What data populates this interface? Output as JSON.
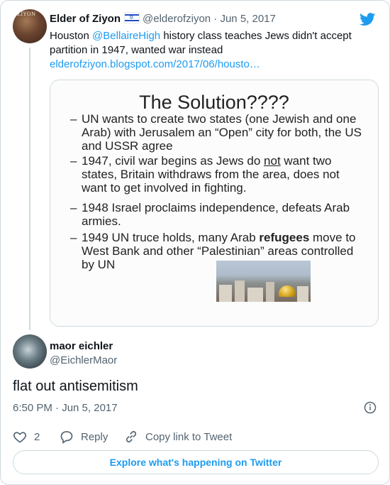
{
  "quoted_tweet": {
    "author_name": "Elder of Ziyon",
    "avatar_text": "ZIYON",
    "handle": "@elderofziyon",
    "separator": "·",
    "date": "Jun 5, 2017",
    "text_part1": "Houston ",
    "mention": "@BellaireHigh",
    "text_part2": " history class teaches Jews didn't accept partition in 1947, wanted war instead",
    "link": "elderofziyon.blogspot.com/2017/06/housto…"
  },
  "slide": {
    "title": "The Solution????",
    "bullets": [
      {
        "dash": "–",
        "text": "UN wants to create two states (one Jewish and one Arab) with Jerusalem an “Open” city for both, the US and USSR agree"
      },
      {
        "dash": "–",
        "text_a": "1947, civil war begins as Jews do ",
        "text_u": "not",
        "text_b": " want two states, Britain withdraws from the area, does not want to get involved in fighting."
      },
      {
        "dash": "–",
        "text": "1948 Israel proclaims independence, defeats Arab armies."
      },
      {
        "dash": "–",
        "text_a": "1949 UN truce holds, many Arab ",
        "text_bold": "refugees",
        "text_b": " move to West Bank and other “Palestinian” areas controlled by UN"
      }
    ]
  },
  "reply": {
    "author_name": "maor eichler",
    "handle": "@EichlerMaor",
    "text": "flat out antisemitism",
    "timestamp": "6:50 PM · Jun 5, 2017"
  },
  "actions": {
    "like_count": "2",
    "reply_label": "Reply",
    "copy_label": "Copy link to Tweet"
  },
  "explore_label": "Explore what's happening on Twitter",
  "colors": {
    "accent": "#1d9bf0",
    "muted": "#536471",
    "border": "#cfd9de"
  }
}
